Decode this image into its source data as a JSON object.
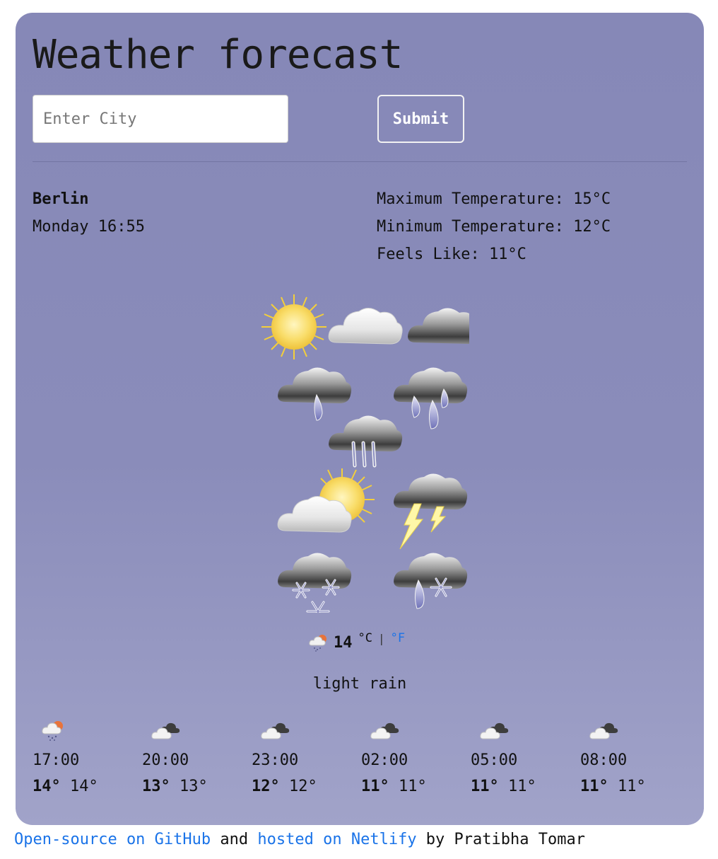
{
  "header": {
    "title": "Weather forecast"
  },
  "search": {
    "placeholder": "Enter City",
    "value": "",
    "submit_label": "Submit"
  },
  "location": {
    "city": "Berlin",
    "datetime": "Monday 16:55"
  },
  "details": {
    "max_temp": "Maximum Temperature: 15°C",
    "min_temp": "Minimum Temperature: 12°C",
    "feels_like": "Feels Like: 11°C"
  },
  "current": {
    "icon": "light-rain-icon",
    "temp": "14",
    "unit_c": "°C",
    "separator": "|",
    "unit_f": "°F",
    "description": "light rain"
  },
  "forecast": [
    {
      "time": "17:00",
      "max": "14°",
      "min": "14°",
      "icon": "sun-rain-icon"
    },
    {
      "time": "20:00",
      "max": "13°",
      "min": "13°",
      "icon": "clouds-icon"
    },
    {
      "time": "23:00",
      "max": "12°",
      "min": "12°",
      "icon": "clouds-icon"
    },
    {
      "time": "02:00",
      "max": "11°",
      "min": "11°",
      "icon": "clouds-icon"
    },
    {
      "time": "05:00",
      "max": "11°",
      "min": "11°",
      "icon": "clouds-icon"
    },
    {
      "time": "08:00",
      "max": "11°",
      "min": "11°",
      "icon": "clouds-icon"
    }
  ],
  "footer": {
    "link1": "Open-source on GitHub",
    "text1": " and ",
    "link2": "hosted on Netlify",
    "text2": " by Pratibha Tomar"
  },
  "colors": {
    "card_bg": "#8688b7",
    "link": "#1a73e8",
    "sun": "#f7d64a"
  }
}
